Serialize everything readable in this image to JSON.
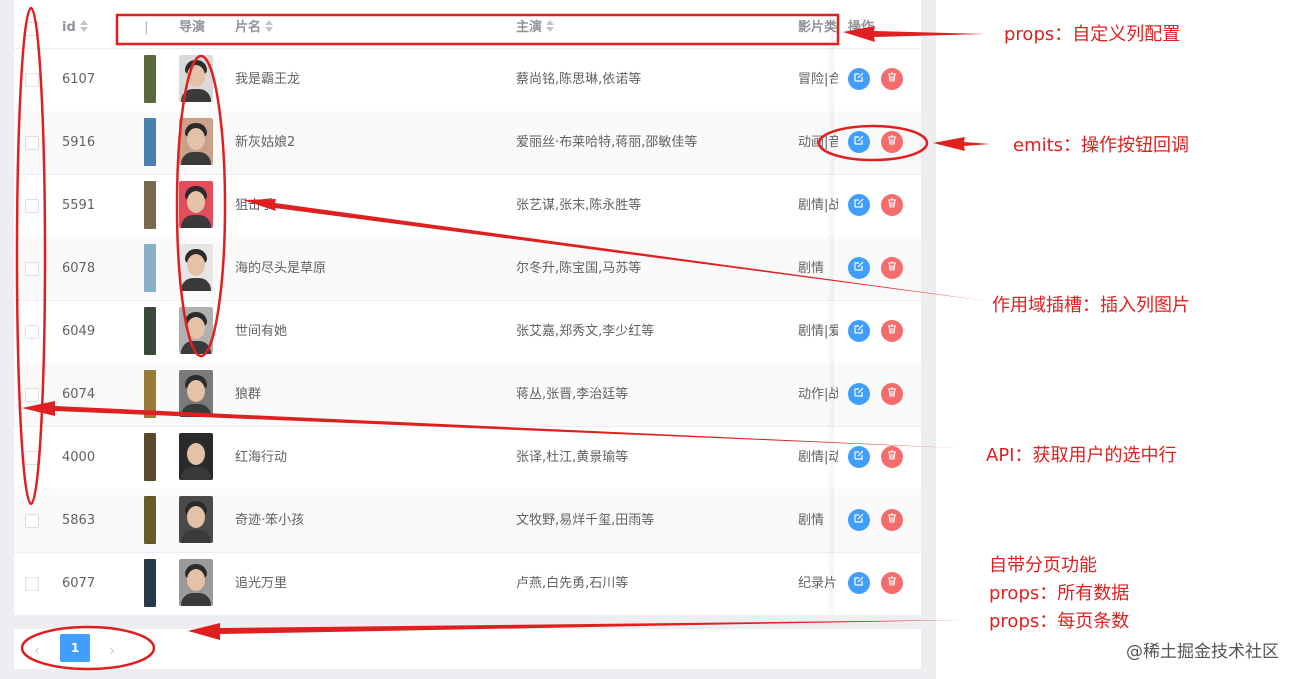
{
  "columns": {
    "id": "id",
    "director": "导演",
    "title": "片名",
    "cast": "主演",
    "genre": "影片类",
    "actions": "操作"
  },
  "rows": [
    {
      "id": "6107",
      "title": "我是霸王龙",
      "cast": "蔡尚铭,陈思琳,依诺等",
      "genre": "冒险|合",
      "poster_color": "#5a6a3a",
      "photo_bg": "#d9d9d9"
    },
    {
      "id": "5916",
      "title": "新灰姑娘2",
      "cast": "爱丽丝·布莱哈特,蒋丽,邵敏佳等",
      "genre": "动画|音",
      "poster_color": "#4a7fb0",
      "photo_bg": "#caa28a"
    },
    {
      "id": "5591",
      "title": "狙击手",
      "cast": "张艺谋,张末,陈永胜等",
      "genre": "剧情|战",
      "poster_color": "#7a6a4a",
      "photo_bg": "#e34c5a"
    },
    {
      "id": "6078",
      "title": "海的尽头是草原",
      "cast": "尔冬升,陈宝国,马苏等",
      "genre": "剧情",
      "poster_color": "#8ab0c8",
      "photo_bg": "#e6e6e6"
    },
    {
      "id": "6049",
      "title": "世间有她",
      "cast": "张艾嘉,郑秀文,李少红等",
      "genre": "剧情|爱",
      "poster_color": "#3a4a3a",
      "photo_bg": "#b0b0b0"
    },
    {
      "id": "6074",
      "title": "狼群",
      "cast": "蒋丛,张晋,李治廷等",
      "genre": "动作|战",
      "poster_color": "#9a7a3a",
      "photo_bg": "#7a7a7a"
    },
    {
      "id": "4000",
      "title": "红海行动",
      "cast": "张译,杜江,黄景瑜等",
      "genre": "剧情|动",
      "poster_color": "#5a4a2a",
      "photo_bg": "#2a2a2a"
    },
    {
      "id": "5863",
      "title": "奇迹·笨小孩",
      "cast": "文牧野,易烊千玺,田雨等",
      "genre": "剧情",
      "poster_color": "#6a5a2a",
      "photo_bg": "#4a4a4a"
    },
    {
      "id": "6077",
      "title": "追光万里",
      "cast": "卢燕,白先勇,石川等",
      "genre": "纪录片",
      "poster_color": "#2a3a4a",
      "photo_bg": "#9a9a9a"
    }
  ],
  "pagination": {
    "prev": "‹",
    "page": "1",
    "next": "›"
  },
  "annotations": {
    "props_columns": "props：自定义列配置",
    "emits": "emits：操作按钮回调",
    "scoped_slot": "作用域插槽：插入列图片",
    "api": "API：获取用户的选中行",
    "pager_line1": "自带分页功能",
    "pager_line2": "props：所有数据",
    "pager_line3": "props：每页条数"
  },
  "watermark": "@稀土掘金技术社区",
  "icons": {
    "edit": "edit-icon",
    "delete": "trash-icon",
    "sort": "sort-caret-icon"
  },
  "colors": {
    "primary": "#409eff",
    "danger": "#f56c6c",
    "annotation": "#e02020"
  }
}
